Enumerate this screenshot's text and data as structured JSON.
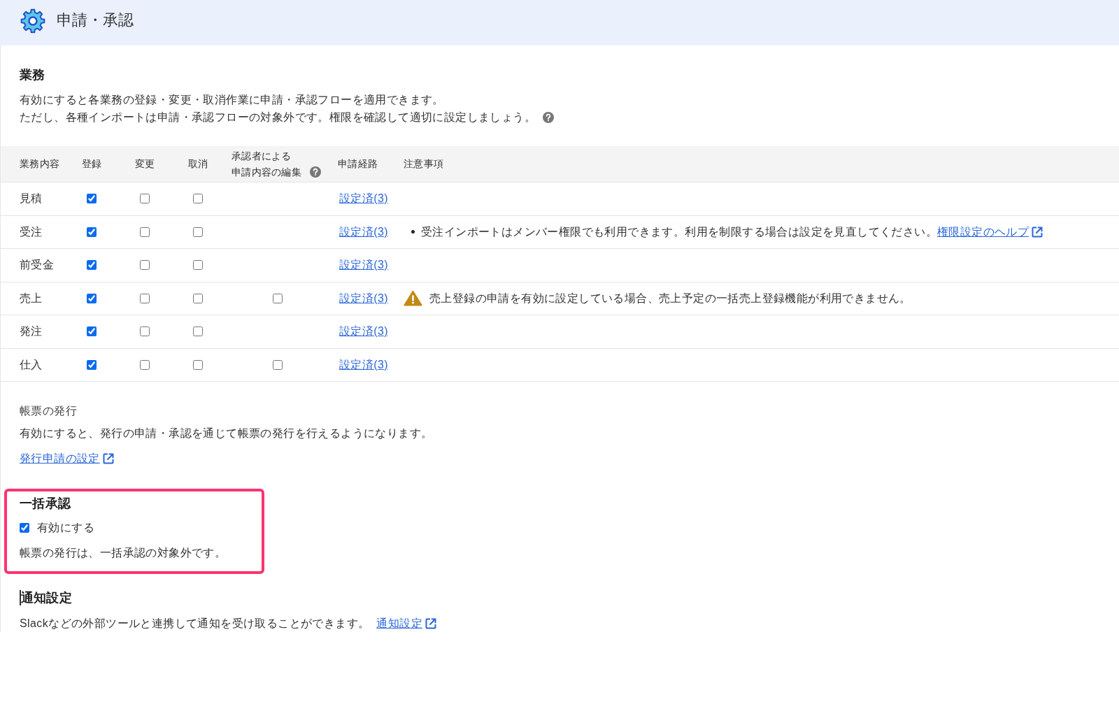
{
  "header": {
    "title": "申請・承認"
  },
  "business": {
    "heading": "業務",
    "description": [
      {
        "text": "有効にすると各業務の登録・変更・取消作業に申請・承認フローを適用できます。",
        "help": false
      },
      {
        "text": "ただし、各種インポートは申請・承認フローの対象外です。権限を確認して適切に設定しましょう。",
        "help": true
      }
    ],
    "columns": [
      {
        "label": "業務内容"
      },
      {
        "label": "登録"
      },
      {
        "label": "変更"
      },
      {
        "label": "取消"
      },
      {
        "lines": [
          "承認者による",
          "申請内容の編集"
        ],
        "help": true
      },
      {
        "label": "申請経路"
      },
      {
        "label": "注意事項"
      }
    ],
    "rows": [
      {
        "name": "見積",
        "register": true,
        "change": false,
        "cancel": false,
        "route": "設定済(3)"
      },
      {
        "name": "受注",
        "register": true,
        "change": false,
        "cancel": false,
        "route": "設定済(3)",
        "note": {
          "kind": "bullet",
          "text": "受注インポートはメンバー権限でも利用できます。利用を制限する場合は設定を見直してください。",
          "link": "権限設定のヘルプ"
        }
      },
      {
        "name": "前受金",
        "register": true,
        "change": false,
        "cancel": false,
        "route": "設定済(3)"
      },
      {
        "name": "売上",
        "register": true,
        "change": false,
        "cancel": false,
        "approver_edit": false,
        "route": "設定済(3)",
        "note": {
          "kind": "warning",
          "text": "売上登録の申請を有効に設定している場合、売上予定の一括売上登録機能が利用できません。"
        }
      },
      {
        "name": "発注",
        "register": true,
        "change": false,
        "cancel": false,
        "route": "設定済(3)"
      },
      {
        "name": "仕入",
        "register": true,
        "change": false,
        "cancel": false,
        "approver_edit": false,
        "route": "設定済(3)"
      }
    ]
  },
  "document_issue": {
    "label": "帳票の発行",
    "description": "有効にすると、発行の申請・承認を通じて帳票の発行を行えるようになります。",
    "link": "発行申請の設定"
  },
  "bulk_approval": {
    "heading": "一括承認",
    "highlighted": true,
    "checkbox": {
      "label": "有効にする",
      "checked": true
    },
    "note": "帳票の発行は、一括承認の対象外です。"
  },
  "notification": {
    "heading": "通知設定",
    "text_cursor": true,
    "description": "Slackなどの外部ツールと連携して通知を受け取ることができます。",
    "link": "通知設定"
  }
}
